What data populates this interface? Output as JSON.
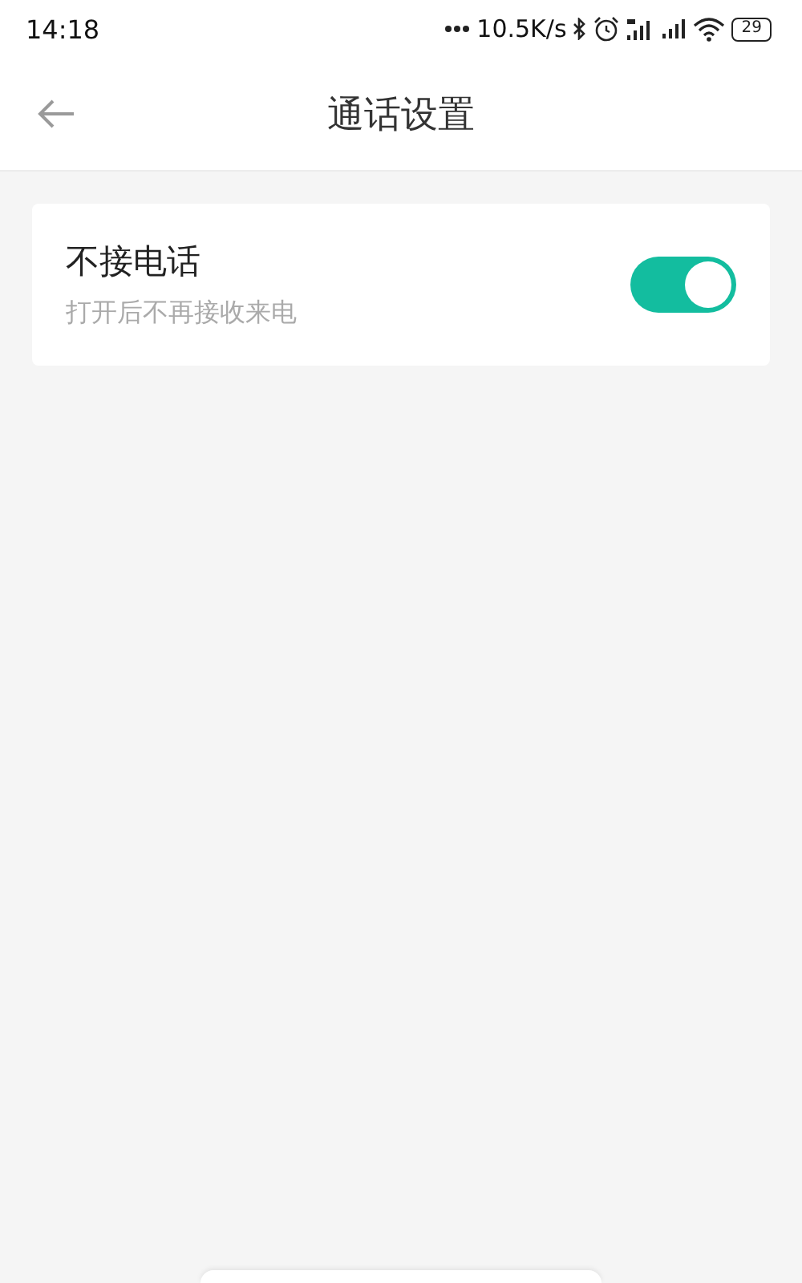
{
  "status_bar": {
    "time": "14:18",
    "net_speed": "10.5K/s",
    "battery": "29"
  },
  "header": {
    "title": "通话设置"
  },
  "settings": [
    {
      "kind": "toggle",
      "title": "不接电话",
      "subtitle": "打开后不再接收来电",
      "on": true
    }
  ]
}
